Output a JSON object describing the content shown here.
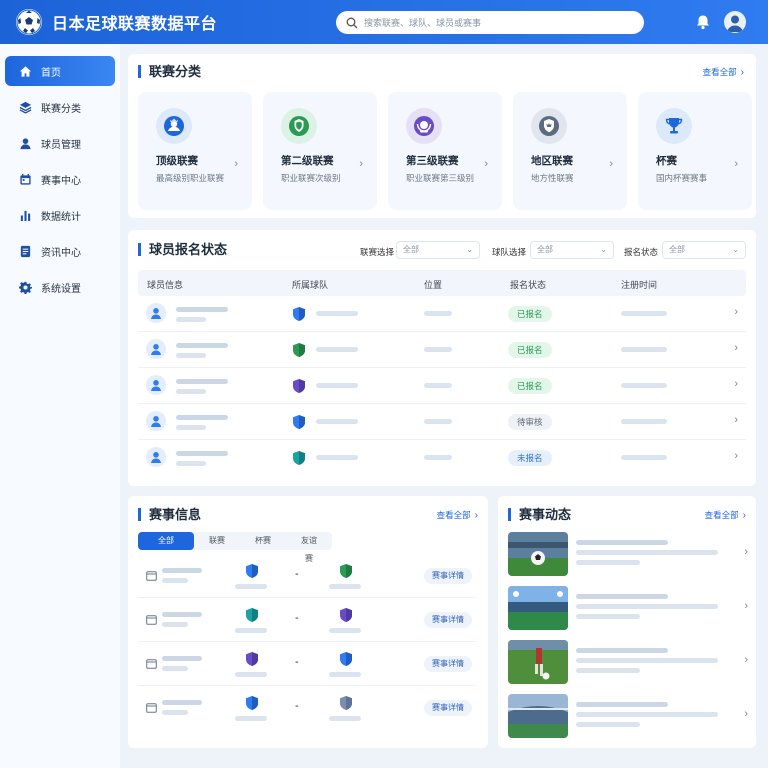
{
  "app": {
    "title": "日本足球联赛数据平台"
  },
  "search": {
    "placeholder": "搜索联赛、球队、球员或赛事"
  },
  "sidebar": {
    "items": [
      {
        "label": "首页",
        "icon": "home-icon",
        "active": true
      },
      {
        "label": "联赛分类",
        "icon": "layers-icon"
      },
      {
        "label": "球员管理",
        "icon": "user-icon"
      },
      {
        "label": "赛事中心",
        "icon": "calendar-icon"
      },
      {
        "label": "数据统计",
        "icon": "bar-chart-icon"
      },
      {
        "label": "资讯中心",
        "icon": "document-icon"
      },
      {
        "label": "系统设置",
        "icon": "gear-icon"
      }
    ]
  },
  "leagues": {
    "title": "联赛分类",
    "view_all": "查看全部",
    "items": [
      {
        "name": "顶级联赛",
        "desc": "最高级别职业联赛",
        "icon": "crown-badge-icon",
        "color": "#1e66dc",
        "bg": "#dce9fb"
      },
      {
        "name": "第二级联赛",
        "desc": "职业联赛次级别",
        "icon": "laurel-badge-icon",
        "color": "#2b9a55",
        "bg": "#dcf2e4"
      },
      {
        "name": "第三级联赛",
        "desc": "职业联赛第三级别",
        "icon": "wreath-badge-icon",
        "color": "#6a4cc7",
        "bg": "#e6e0f7"
      },
      {
        "name": "地区联赛",
        "desc": "地方性联赛",
        "icon": "shield-badge-icon",
        "color": "#5b6b80",
        "bg": "#e1e6ee"
      },
      {
        "name": "杯赛",
        "desc": "国内杯赛赛事",
        "icon": "trophy-icon",
        "color": "#1e66dc",
        "bg": "#dce9fb"
      }
    ]
  },
  "registration": {
    "title": "球员报名状态",
    "filters": [
      {
        "label": "联赛选择",
        "value": "全部"
      },
      {
        "label": "球队选择",
        "value": "全部"
      },
      {
        "label": "报名状态",
        "value": "全部"
      }
    ],
    "columns": [
      "球员信息",
      "所属球队",
      "位置",
      "报名状态",
      "注册时间"
    ],
    "rows": [
      {
        "status": "已报名",
        "kind": "ok",
        "shield": "#2f7bf0"
      },
      {
        "status": "已报名",
        "kind": "ok",
        "shield": "#2b9a55"
      },
      {
        "status": "已报名",
        "kind": "ok",
        "shield": "#6a4cc7"
      },
      {
        "status": "待审核",
        "kind": "wait",
        "shield": "#2f7bf0"
      },
      {
        "status": "未报名",
        "kind": "no",
        "shield": "#1aa3a3"
      }
    ]
  },
  "matches": {
    "title": "赛事信息",
    "view_all": "查看全部",
    "tabs": [
      "全部",
      "联赛",
      "杯赛",
      "友谊赛"
    ],
    "vs": "-",
    "detail_label": "赛事详情",
    "rows": [
      {
        "home": "#2f7bf0",
        "away": "#2b9a55"
      },
      {
        "home": "#1aa3a3",
        "away": "#6a4cc7"
      },
      {
        "home": "#6a4cc7",
        "away": "#2f7bf0"
      },
      {
        "home": "#2f7bf0",
        "away": "#7a8fb0"
      }
    ]
  },
  "news": {
    "title": "赛事动态",
    "view_all": "查看全部",
    "count": 4
  }
}
